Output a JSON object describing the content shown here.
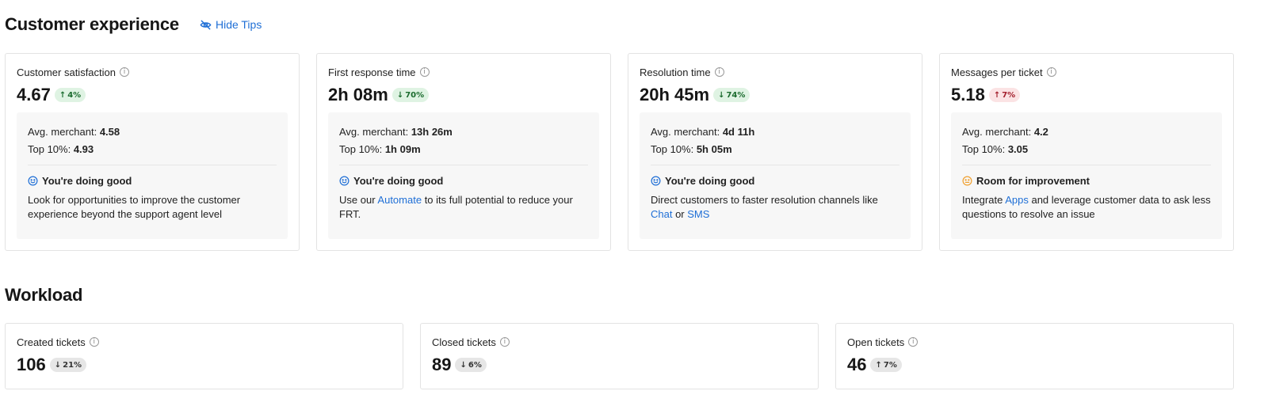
{
  "customer_experience": {
    "title": "Customer experience",
    "hide_tips": "Hide Tips",
    "cards": [
      {
        "label": "Customer satisfaction",
        "value": "4.67",
        "badge": {
          "direction": "up",
          "text": "4%",
          "tone": "green"
        },
        "avg_label": "Avg. merchant: ",
        "avg_value": "4.58",
        "top_label": "Top 10%: ",
        "top_value": "4.93",
        "status": "You're doing good",
        "status_tone": "good",
        "tip_a": "Look for opportunities to improve the customer experience beyond the support agent level",
        "link1": "",
        "tip_b": "",
        "link2": "",
        "tip_c": ""
      },
      {
        "label": "First response time",
        "value": "2h 08m",
        "badge": {
          "direction": "down",
          "text": "70%",
          "tone": "green"
        },
        "avg_label": "Avg. merchant: ",
        "avg_value": "13h 26m",
        "top_label": "Top 10%: ",
        "top_value": "1h 09m",
        "status": "You're doing good",
        "status_tone": "good",
        "tip_a": "Use our ",
        "link1": "Automate",
        "tip_b": " to its full potential to reduce your FRT.",
        "link2": "",
        "tip_c": ""
      },
      {
        "label": "Resolution time",
        "value": "20h 45m",
        "badge": {
          "direction": "down",
          "text": "74%",
          "tone": "green"
        },
        "avg_label": "Avg. merchant: ",
        "avg_value": "4d 11h",
        "top_label": "Top 10%: ",
        "top_value": "5h 05m",
        "status": "You're doing good",
        "status_tone": "good",
        "tip_a": "Direct customers to faster resolution channels like ",
        "link1": "Chat",
        "tip_b": " or ",
        "link2": "SMS",
        "tip_c": ""
      },
      {
        "label": "Messages per ticket",
        "value": "5.18",
        "badge": {
          "direction": "up",
          "text": "7%",
          "tone": "red"
        },
        "avg_label": "Avg. merchant: ",
        "avg_value": "4.2",
        "top_label": "Top 10%: ",
        "top_value": "3.05",
        "status": "Room for improvement",
        "status_tone": "warn",
        "tip_a": "Integrate ",
        "link1": "Apps",
        "tip_b": " and leverage customer data to ask less questions to resolve an issue",
        "link2": "",
        "tip_c": ""
      }
    ]
  },
  "workload": {
    "title": "Workload",
    "cards": [
      {
        "label": "Created tickets",
        "value": "106",
        "badge": {
          "direction": "down",
          "text": "21%",
          "tone": "grey"
        }
      },
      {
        "label": "Closed tickets",
        "value": "89",
        "badge": {
          "direction": "down",
          "text": "6%",
          "tone": "grey"
        }
      },
      {
        "label": "Open tickets",
        "value": "46",
        "badge": {
          "direction": "up",
          "text": "7%",
          "tone": "grey"
        }
      }
    ]
  },
  "colors": {
    "link": "#1f6fd6",
    "good_icon": "#1f6fd6",
    "warn_icon": "#f0a030",
    "badge_green_bg": "#dff3e3",
    "badge_red_bg": "#fbe3e4",
    "badge_grey_bg": "#e6e6e6"
  },
  "icons": {
    "hide_tips": "eye-off-icon",
    "info": "info-icon",
    "good": "smiley-icon",
    "warn": "neutral-face-icon",
    "arrow_up": "arrow-up-icon",
    "arrow_down": "arrow-down-icon"
  }
}
